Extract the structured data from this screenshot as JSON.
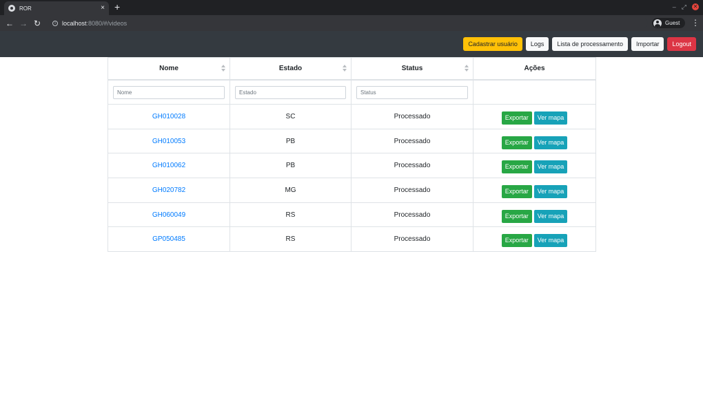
{
  "browser": {
    "tab_title": "ROR",
    "tab_close": "×",
    "new_tab": "+",
    "url_host": "localhost",
    "url_path": ":8080/#/videos",
    "profile_label": "Guest",
    "back": "←",
    "forward": "→",
    "reload": "↻",
    "menu": "⋮",
    "minimize": "–",
    "restore": "⤢",
    "close": "✕"
  },
  "navbar": {
    "buttons": [
      {
        "label": "Cadastrar usuário",
        "variant": "warning"
      },
      {
        "label": "Logs",
        "variant": "light"
      },
      {
        "label": "Lista de processamento",
        "variant": "light"
      },
      {
        "label": "Importar",
        "variant": "light"
      },
      {
        "label": "Logout",
        "variant": "danger"
      }
    ]
  },
  "table": {
    "headers": {
      "nome": "Nome",
      "estado": "Estado",
      "status": "Status",
      "acoes": "Ações"
    },
    "filters": {
      "nome_placeholder": "Nome",
      "estado_placeholder": "Estado",
      "status_placeholder": "Status"
    },
    "rows": [
      {
        "nome": "GH010028",
        "estado": "SC",
        "status": "Processado"
      },
      {
        "nome": "GH010053",
        "estado": "PB",
        "status": "Processado"
      },
      {
        "nome": "GH010062",
        "estado": "PB",
        "status": "Processado"
      },
      {
        "nome": "GH020782",
        "estado": "MG",
        "status": "Processado"
      },
      {
        "nome": "GH060049",
        "estado": "RS",
        "status": "Processado"
      },
      {
        "nome": "GP050485",
        "estado": "RS",
        "status": "Processado"
      }
    ],
    "action_labels": {
      "exportar": "Exportar",
      "ver_mapa": "Ver mapa"
    }
  },
  "colors": {
    "navbar_bg": "#343a40",
    "warning": "#ffc107",
    "danger": "#dc3545",
    "success": "#28a745",
    "info": "#17a2b8",
    "link": "#007bff"
  }
}
